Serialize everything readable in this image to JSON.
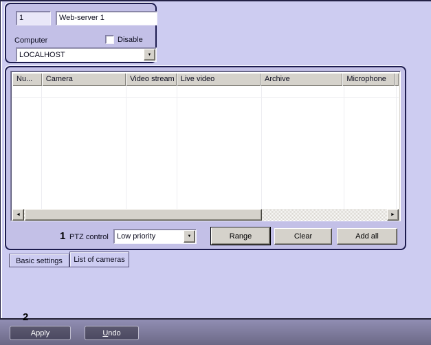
{
  "server": {
    "id_value": "1",
    "name_value": "Web-server 1",
    "computer_label": "Computer",
    "disable_label": "Disable",
    "computer_value": "LOCALHOST"
  },
  "cameras_table": {
    "columns": [
      {
        "label": "Nu..."
      },
      {
        "label": "Camera"
      },
      {
        "label": "Video stream"
      },
      {
        "label": "Live video"
      },
      {
        "label": "Archive"
      },
      {
        "label": "Microphone"
      }
    ],
    "rows": []
  },
  "ptz": {
    "step_marker": "1",
    "label": "PTZ control",
    "selected_value": "Low priority",
    "range_label": "Range",
    "clear_label": "Clear",
    "add_all_label": "Add all"
  },
  "tabs": [
    {
      "label": "Basic settings",
      "active": false
    },
    {
      "label": "List of cameras",
      "active": true
    }
  ],
  "footer": {
    "step_marker": "2",
    "apply_label": "Apply",
    "undo_shortcut_prefix": "U",
    "undo_rest": "ndo",
    "undo_label": "Undo"
  },
  "icons": {
    "combo_arrow": "▼",
    "scroll_left_arrow": "◄",
    "scroll_right_arrow": "►"
  },
  "colors": {
    "page_bg": "#cdccf1",
    "panel_fill": "#c3c0e7",
    "panel_border": "#1c1b4e",
    "control_gray": "#d5d2cb",
    "footer_top": "#918eb3",
    "footer_bottom": "#6c6986",
    "footer_button": "#53506a"
  }
}
